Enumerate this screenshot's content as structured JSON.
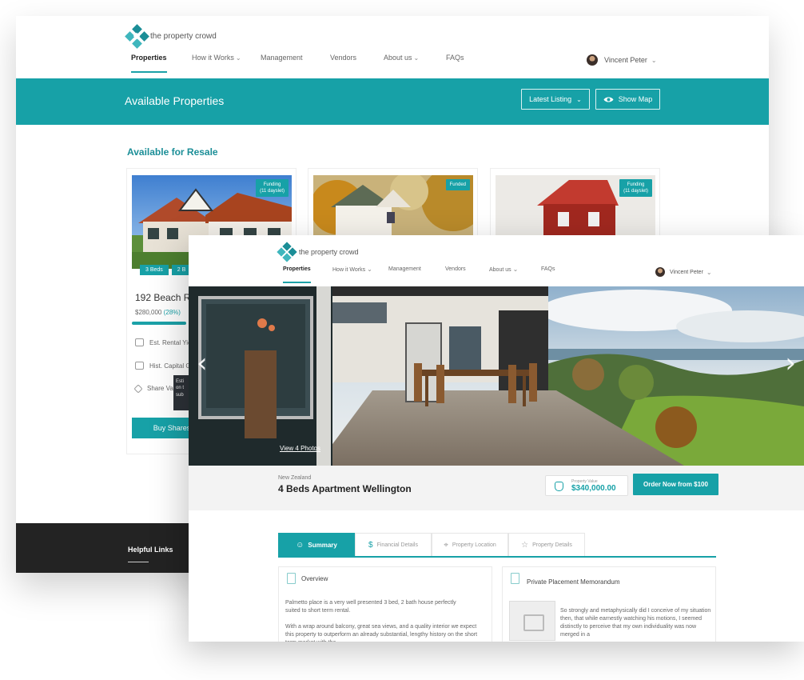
{
  "brand": "the property crowd",
  "colors": {
    "teal": "#17a1a7",
    "footer": "#232323"
  },
  "back_window": {
    "nav": {
      "items": [
        "Properties",
        "How it Works",
        "Management",
        "Vendors",
        "About us",
        "FAQs"
      ],
      "active": "Properties"
    },
    "user": "Vincent Peter",
    "banner": {
      "title": "Available Properties",
      "sort_label": "Latest Listing",
      "map_button": "Show Map"
    },
    "section_title": "Available for Resale",
    "cards": [
      {
        "badge_line1": "Funding",
        "badge_line2": "(11 dayslet)",
        "tags": [
          "3 Beds",
          "2 B"
        ],
        "address": "192 Beach Ro",
        "price": "$280,000",
        "percent": "(28%)",
        "rows": [
          "Est. Rental Yie",
          "Hist. Capital Ga",
          "Share Va"
        ],
        "tooltip_lines": [
          "Esti",
          "on t",
          "sub"
        ],
        "buy_label": "Buy Shares"
      },
      {
        "badge_line1": "Funded",
        "badge_line2": ""
      },
      {
        "badge_line1": "Funding",
        "badge_line2": "(11 dayslet)"
      }
    ],
    "footer": {
      "heading": "Helpful Links"
    }
  },
  "front_window": {
    "nav": {
      "items": [
        "Properties",
        "How it Works",
        "Management",
        "Vendors",
        "About us",
        "FAQs"
      ],
      "active": "Properties"
    },
    "user": "Vincent Peter",
    "view_photos": "View 4 Photos",
    "property": {
      "country": "New Zealand",
      "name": "4 Beds Apartment Wellington",
      "value_label": "Property Value",
      "value": "$340,000.00",
      "order_label": "Order Now from $100"
    },
    "tabs": [
      "Summary",
      "Financial Details",
      "Property Location",
      "Property Details"
    ],
    "active_tab": "Summary",
    "overview": {
      "title": "Overview",
      "p1": "Palmetto place is a very well presented 3 bed, 2 bath house perfectly suited to short term rental.",
      "p2": "With a wrap around balcony, great sea views, and a quality interior we expect this property to outperform an already substantial, lengthy history on the short term market with the"
    },
    "ppm": {
      "title": "Private Placement Memorandum",
      "text": "So strongly and metaphysically did I conceive of my situation then, that while earnestly watching his motions, I seemed distinctly to perceive that my own individuality was now merged in a"
    }
  }
}
